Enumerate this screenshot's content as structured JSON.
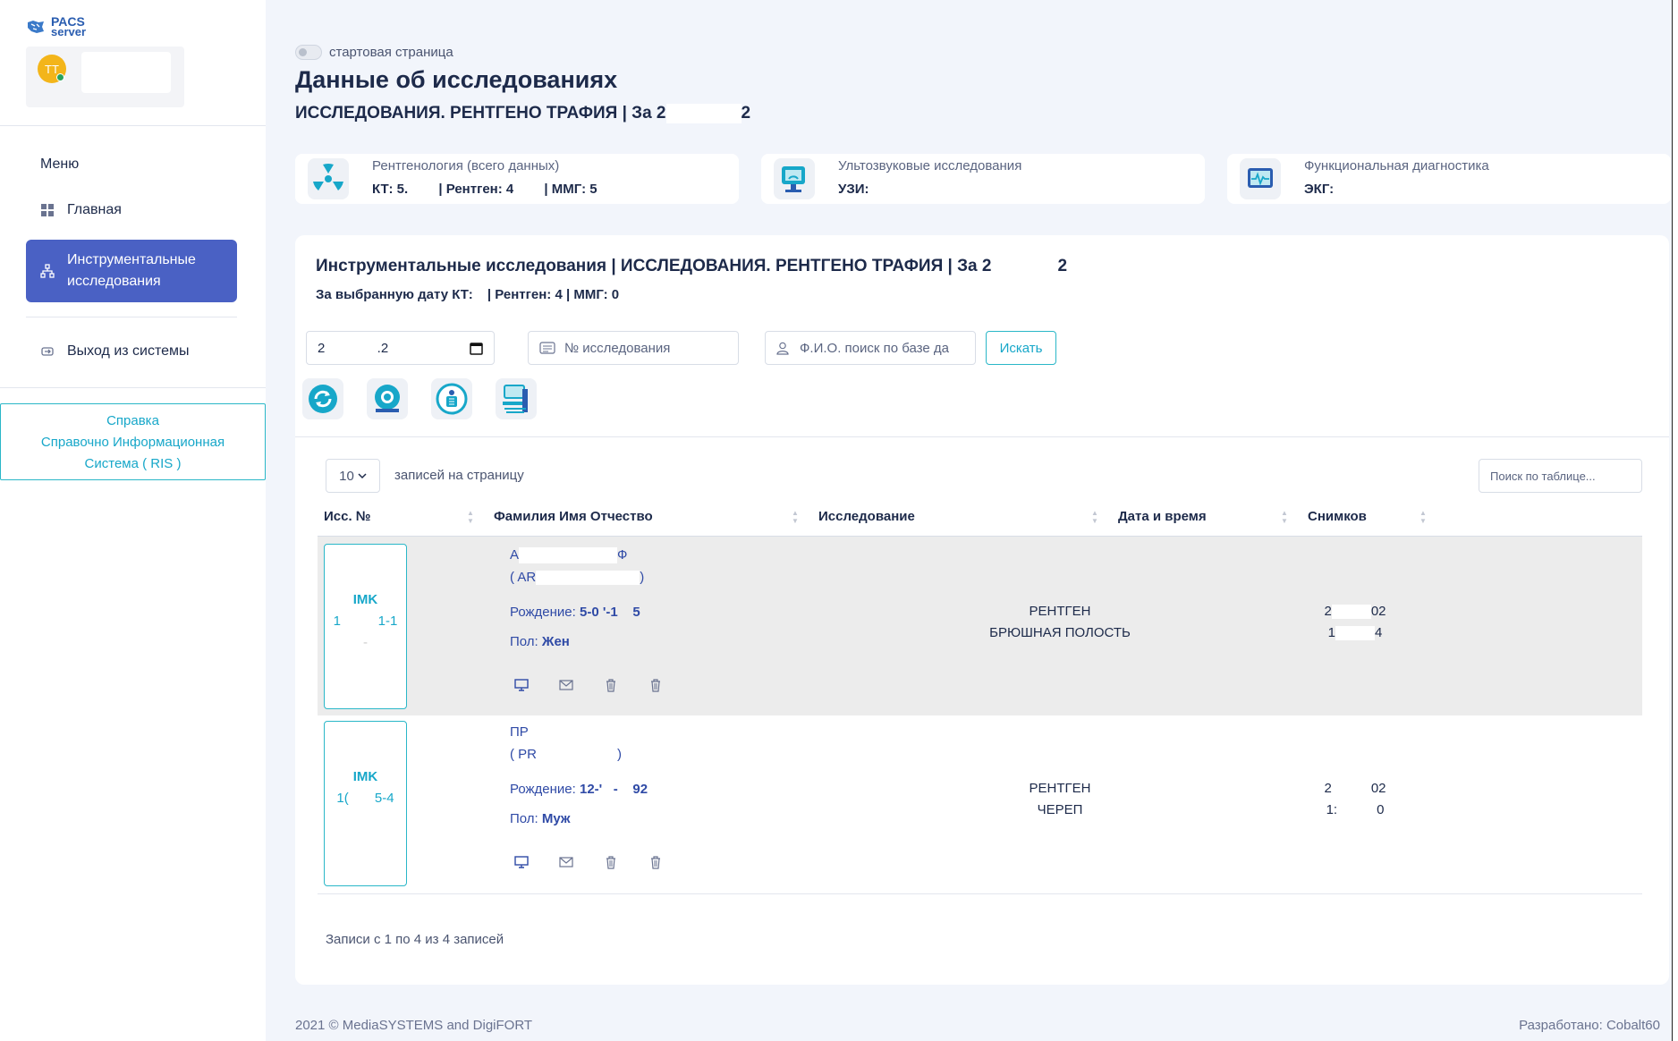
{
  "app": {
    "logo_line1": "PACS",
    "logo_line2": "server",
    "user_initials": "TT"
  },
  "sidebar": {
    "menu_title": "Меню",
    "items": [
      {
        "label": "Главная",
        "icon": "grid-icon"
      },
      {
        "label": "Инструментальные исследования",
        "icon": "sitemap-icon"
      },
      {
        "label": "Выход из системы",
        "icon": "logout-icon"
      }
    ],
    "help": {
      "line1": "Справка",
      "line2": "Справочно Информационная",
      "line3": "Система ( RIS )"
    }
  },
  "header": {
    "toggle_label": "стартовая страница",
    "title": "Данные об исследованиях",
    "subtitle_prefix": "ИССЛЕДОВАНИЯ. РЕНТГЕНО ТРАФИЯ | За 2",
    "subtitle_suffix": "2"
  },
  "stats": [
    {
      "label": "Рентгенология (всего данных)",
      "value_1": "КТ: 5.",
      "value_2": "| Рентген: 4",
      "value_3": "| ММГ: 5",
      "icon": "radiation-icon"
    },
    {
      "label": "Ультозвуковые исследования",
      "value_1": "УЗИ:",
      "icon": "ultrasound-icon"
    },
    {
      "label": "Функциональная диагностика",
      "value_1": "ЭКГ:",
      "icon": "ecg-monitor-icon"
    }
  ],
  "panel": {
    "title_prefix": "Инструментальные исследования | ИССЛЕДОВАНИЯ. РЕНТГЕНО ТРАФИЯ | За 2",
    "title_suffix": "2",
    "sub_1": "За выбранную дату КТ:",
    "sub_2": "| Рентген: 4",
    "sub_3": "| ММГ: 0"
  },
  "filters": {
    "date_value": "2              .2",
    "study_number_placeholder": "№ исследования",
    "name_placeholder": "Ф.И.О. поиск по базе да",
    "search_label": "Искать"
  },
  "modality_buttons": [
    "refresh-icon",
    "ct-scanner-icon",
    "xray-person-icon",
    "radiography-machine-icon"
  ],
  "table": {
    "page_size": "10",
    "page_size_label": "записей на страницу",
    "search_placeholder": "Поиск по таблице...",
    "columns": [
      "Исс. №",
      "Фамилия Имя Отчество",
      "Исследование",
      "Дата и время",
      "Снимков"
    ],
    "rows": [
      {
        "id_prefix": "IMK",
        "id_number": "1          1-1",
        "id_extra": "-",
        "name": "А",
        "name_end": "Ф",
        "latin_name": "( AR",
        "latin_end": ")",
        "birth_label": "Рождение:",
        "birth_value": "5-0 '-1    5",
        "sex_label": "Пол:",
        "sex_value": "Жен",
        "study_type": "РЕНТГЕН",
        "study_area": "БРЮШНАЯ ПОЛОСТЬ",
        "date": "2",
        "date_end": "02",
        "time": "1",
        "time_end": "4"
      },
      {
        "id_prefix": "IMK",
        "id_number": "1(       5-4",
        "id_extra": "",
        "name": "ПР",
        "name_end": "",
        "latin_name": "( PR",
        "latin_end": ")",
        "birth_label": "Рождение:",
        "birth_value": "12-'   -    92",
        "sex_label": "Пол:",
        "sex_value": "Муж",
        "study_type": "РЕНТГЕН",
        "study_area": "ЧЕРЕП",
        "date": "2",
        "date_end": "02",
        "time": "1:",
        "time_end": "0"
      }
    ],
    "records_info": "Записи с 1 по 4 из 4 записей"
  },
  "footer": {
    "left": "2021 © MediaSYSTEMS and DigiFORT",
    "right": "Разработано: Cobalt60"
  },
  "colors": {
    "accent": "#4a61c4",
    "teal": "#17a7c9",
    "background": "#f2f5fb",
    "row_shade": "#ececec"
  }
}
